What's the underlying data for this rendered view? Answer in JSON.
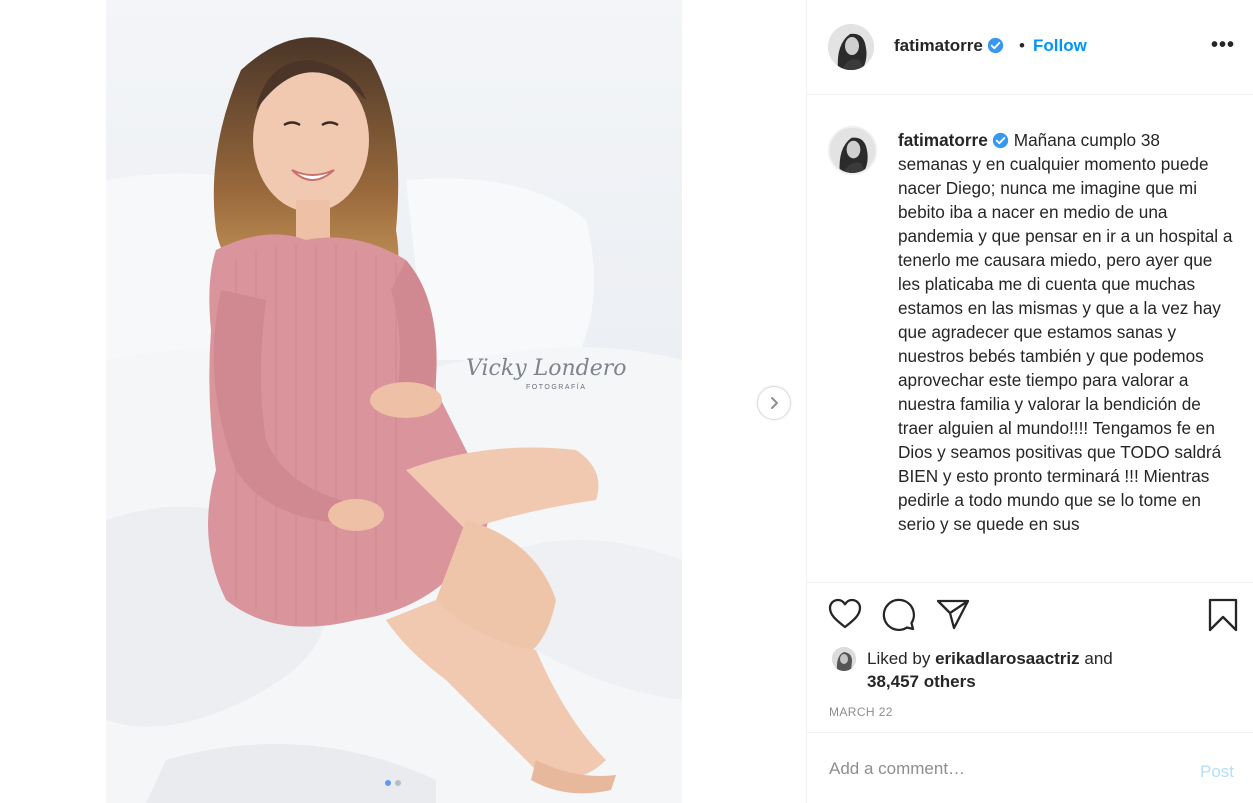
{
  "post": {
    "username": "fatimatorre",
    "follow_label": "Follow",
    "bullet": "•",
    "more_label": "•••",
    "photo_watermark_line1": "Vicky Londero",
    "photo_watermark_line2": "FOTOGRAFÍA",
    "caption_text": "Mañana cumplo 38 semanas y en cualquier momento puede nacer Diego; nunca me imagine que mi bebito iba a nacer en medio de una pandemia y que pensar en ir a un hospital a tenerlo me causara miedo, pero ayer que les platicaba me di cuenta que muchas estamos en las mismas y que a la vez hay que agradecer que estamos sanas y nuestros bebés también y que podemos aprovechar este tiempo para valorar a nuestra familia y valorar la bendición de traer alguien al mundo!!!! Tengamos fe en Dios y seamos positivas que TODO saldrá BIEN y esto pronto terminará !!! Mientras pedirle a todo mundo que se lo tome en serio y se quede en sus",
    "likes_prefix": "Liked by",
    "liked_by_user": "erikadlarosaactriz",
    "likes_and": "and",
    "others_count": "38,457 others",
    "date": "MARCH 22",
    "comment_placeholder": "Add a comment…",
    "post_label": "Post"
  },
  "icons": {
    "like": "heart-icon",
    "comment": "comment-bubble-icon",
    "share": "paper-plane-icon",
    "save": "bookmark-icon",
    "verified": "verified-badge-icon",
    "next": "chevron-right-icon"
  },
  "colors": {
    "link_blue": "#0095f6",
    "verified_blue": "#3897f0",
    "post_disabled": "#b2dffc",
    "meta_gray": "#8e8e8e",
    "dress_pink": "#d9949c"
  },
  "carousel": {
    "slide_count": 2,
    "active_slide": 1
  }
}
